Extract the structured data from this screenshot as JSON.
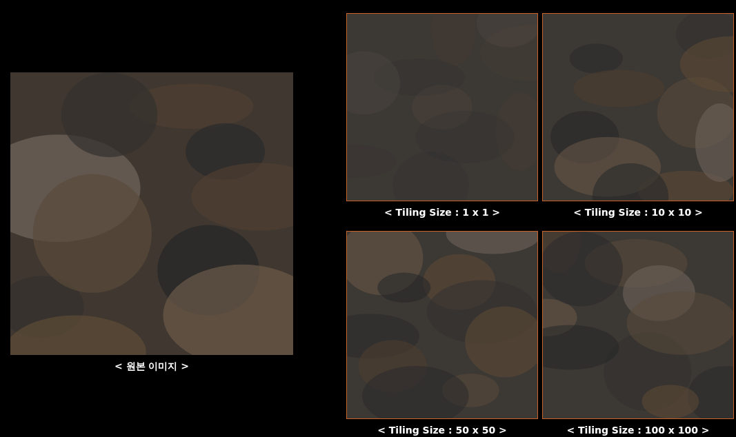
{
  "original": {
    "caption": "< 원본 이미지 >"
  },
  "tiles": [
    {
      "caption": "< Tiling Size : 1 x 1 >"
    },
    {
      "caption": "< Tiling Size : 10 x 10 >"
    },
    {
      "caption": "< Tiling Size : 50 x 50 >"
    },
    {
      "caption": "< Tiling Size : 100 x 100 >"
    }
  ]
}
